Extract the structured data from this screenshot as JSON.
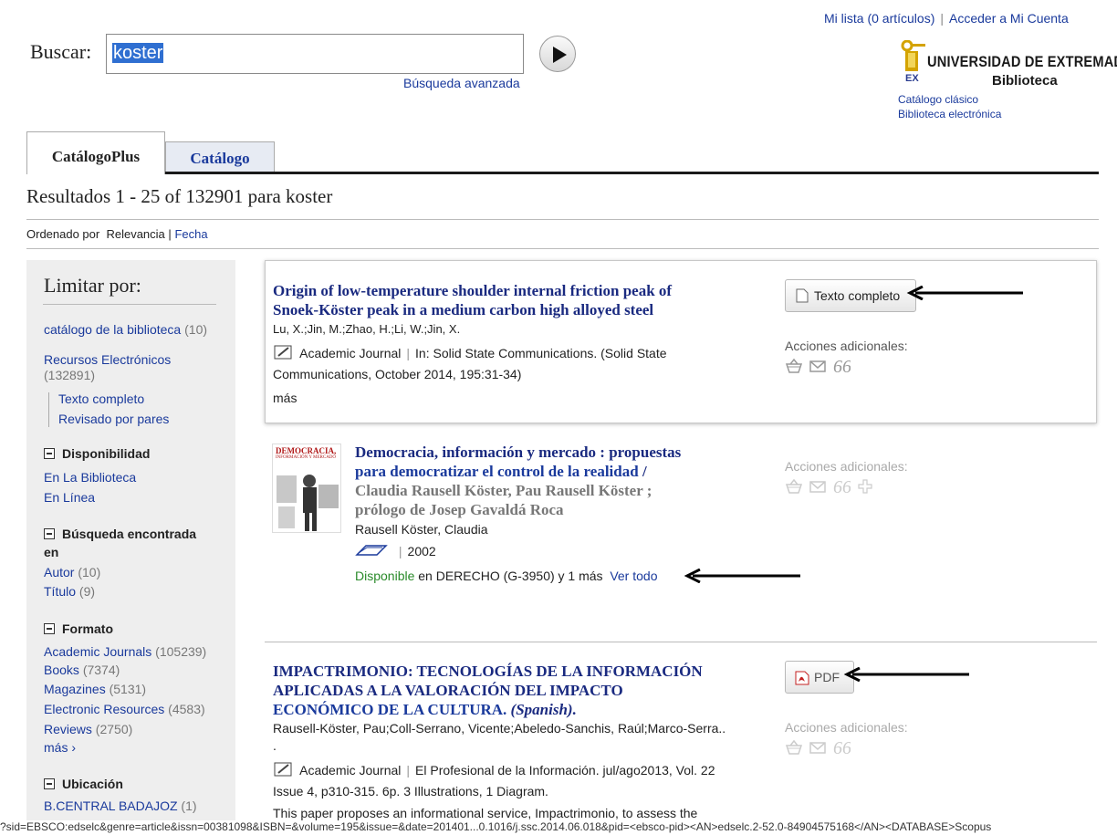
{
  "header": {
    "search_label": "Buscar:",
    "search_value": "koster",
    "advanced_search": "Búsqueda avanzada",
    "my_list": "Mi lista (0 artículos)",
    "login": "Acceder a Mi Cuenta",
    "logo_title": "UNIVERSIDAD DE EXTREMADURA",
    "logo_ex": "EX",
    "logo_subtitle": "Biblioteca",
    "classic_catalog": "Catálogo clásico",
    "electronic_library": "Biblioteca electrónica"
  },
  "tabs": [
    {
      "label": "CatálogoPlus",
      "active": true
    },
    {
      "label": "Catálogo",
      "active": false
    }
  ],
  "results_heading": "Resultados 1 - 25 of 132901 para koster",
  "sort": {
    "label": "Ordenado por",
    "options": [
      "Relevancia",
      "Fecha"
    ],
    "sep": "|"
  },
  "sidebar": {
    "title": "Limitar por:",
    "catalogo": {
      "label": "catálogo de la biblioteca",
      "count": "(10)"
    },
    "recursos": {
      "label": "Recursos Electrónicos",
      "count": "(132891)"
    },
    "sub_items": [
      "Texto completo",
      "Revisado por pares"
    ],
    "disponibilidad": {
      "heading": "Disponibilidad",
      "items": [
        "En La Biblioteca",
        "En Línea"
      ]
    },
    "busqueda": {
      "heading": "Búsqueda encontrada",
      "heading2": "en",
      "items": [
        {
          "label": "Autor",
          "count": "(10)"
        },
        {
          "label": "Título",
          "count": "(9)"
        }
      ]
    },
    "formato": {
      "heading": "Formato",
      "items": [
        {
          "label": "Academic Journals",
          "count": "(105239)"
        },
        {
          "label": "Books",
          "count": "(7374)"
        },
        {
          "label": "Magazines",
          "count": "(5131)"
        },
        {
          "label": "Electronic Resources",
          "count": "(4583)"
        },
        {
          "label": "Reviews",
          "count": "(2750)"
        }
      ],
      "more": "más ›"
    },
    "ubicacion": {
      "heading": "Ubicación",
      "items": [
        {
          "label": "B.CENTRAL BADAJOZ",
          "count": "(1)"
        }
      ]
    }
  },
  "results": [
    {
      "title_l1": "Origin of low-temperature shoulder internal friction peak of",
      "title_l2": "Snoek-Köster peak in a medium carbon high alloyed steel",
      "authors": "Lu, X.;Jin, M.;Zhao, H.;Li, W.;Jin, X.",
      "type": "Academic Journal",
      "source_l1": "In: Solid State Communications. (Solid State",
      "source_l2": "Communications, October 2014, 195:31-34)",
      "more": "más",
      "fulltext_button": "Texto completo",
      "actions_label": "Acciones adicionales:"
    },
    {
      "title_l1": "Democracia, información y mercado : propuestas",
      "title_l2": "para democratizar el control de la realidad",
      "title_l2_suffix": " /",
      "title_l3": "Claudia Rausell Köster, Pau Rausell Köster ;",
      "title_l4": "prólogo de Josep Gavaldá Roca",
      "author": "Rausell Köster, Claudia",
      "year": "2002",
      "availability_status": "Disponible",
      "availability_text": " en DERECHO (G-3950) y 1 más",
      "view_all": "Ver todo",
      "actions_label": "Acciones adicionales:",
      "cover_title": "DEMOCRACIA,",
      "cover_sub": "INFORMACIÓN Y MERCADO"
    },
    {
      "title_l1": "IMPACTRIMONIO: TECNOLOGÍAS DE LA INFORMACIÓN",
      "title_l2": "APLICADAS A LA VALORACIÓN DEL IMPACTO",
      "title_l3": "ECONÓMICO DE LA CULTURA.",
      "title_l3_italic": " (Spanish).",
      "authors": "Rausell-Köster, Pau;Coll-Serrano, Vicente;Abeledo-Sanchis, Raúl;Marco-Serra..",
      "authors_dot": ".",
      "type": "Academic Journal",
      "source_l1": "El Profesional de la Información. jul/ago2013, Vol. 22",
      "source_l2": "Issue 4, p310-315. 6p. 3 Illustrations, 1 Diagram.",
      "abstract": "This paper proposes an informational service, Impactrimonio, to assess the",
      "pdf_button": "PDF",
      "actions_label": "Acciones adicionales:"
    }
  ],
  "status_bar": "?sid=EBSCO:edselc&genre=article&issn=00381098&ISBN=&volume=195&issue=&date=201401...0.1016/j.ssc.2014.06.018&pid=<ebsco-pid><AN>edselc.2-52.0-84904575168</AN><DATABASE>Scopus",
  "colors": {
    "link": "#1a3a9c",
    "title": "#1a2a80",
    "available": "#2a8a2a",
    "sidebar_bg": "#eeeeee",
    "selection": "#2f6fd1"
  }
}
